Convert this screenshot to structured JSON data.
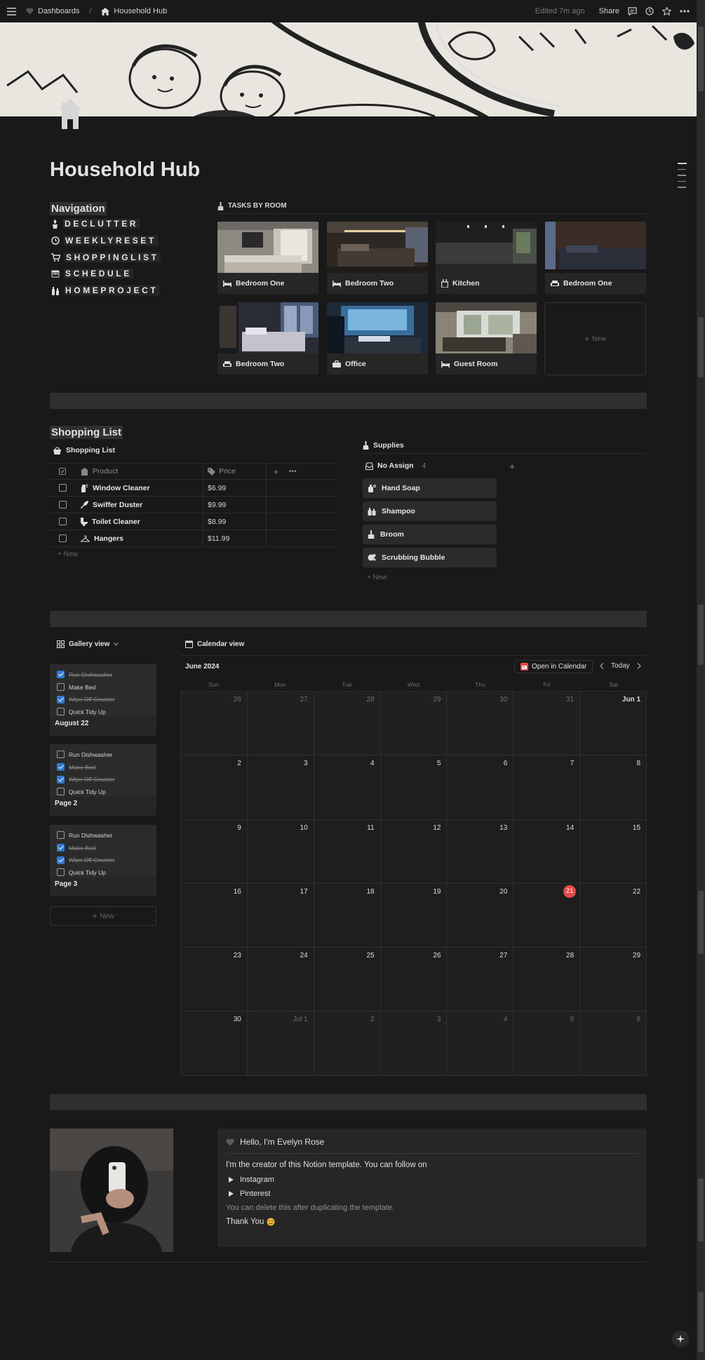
{
  "topbar": {
    "breadcrumb_parent": "Dashboards",
    "breadcrumb_current": "Household Hub",
    "edited": "Edited 7m ago",
    "share": "Share"
  },
  "page": {
    "title": "Household Hub"
  },
  "navigation": {
    "heading": "Navigation",
    "items": [
      {
        "label": "DECLUTTER",
        "icon": "broom-icon"
      },
      {
        "label": "WEEKLYRESET",
        "icon": "clock-icon"
      },
      {
        "label": "SHOPPINGLIST",
        "icon": "cart-icon"
      },
      {
        "label": "SCHEDULE",
        "icon": "calendar-icon"
      },
      {
        "label": "HOMEPROJECT",
        "icon": "bottles-icon"
      }
    ]
  },
  "rooms": {
    "header": "TASKS BY ROOM",
    "cards": [
      {
        "name": "Bedroom One",
        "icon": "bed-icon"
      },
      {
        "name": "Bedroom Two",
        "icon": "bed-icon"
      },
      {
        "name": "Kitchen",
        "icon": "kitchen-icon"
      },
      {
        "name": "Bedroom One",
        "icon": "sofa-icon"
      },
      {
        "name": "Bedroom Two",
        "icon": "sofa-icon"
      },
      {
        "name": "Office",
        "icon": "briefcase-icon"
      },
      {
        "name": "Guest Room",
        "icon": "bed-icon"
      }
    ],
    "new_label": "New"
  },
  "shopping": {
    "heading": "Shopping List",
    "db_title": "Shopping List",
    "columns": {
      "product": "Product",
      "price": "Price"
    },
    "rows": [
      {
        "product": "Window Cleaner",
        "price": "$6.99"
      },
      {
        "product": "Swiffer Duster",
        "price": "$9.99"
      },
      {
        "product": "Toilet Cleaner",
        "price": "$8.99"
      },
      {
        "product": "Hangers",
        "price": "$11.99"
      }
    ],
    "new_label": "New"
  },
  "supplies": {
    "header": "Supplies",
    "group": "No Assign",
    "count": "4",
    "items": [
      "Hand Soap",
      "Shampoo",
      "Broom",
      "Scrubbing Bubble"
    ],
    "new_label": "New"
  },
  "gallery": {
    "tab": "Gallery view",
    "cards": [
      {
        "title": "August 22",
        "tasks": [
          {
            "label": "Run Dishwasher",
            "done": true
          },
          {
            "label": "Make Bed",
            "done": false
          },
          {
            "label": "Wipe Off Counter",
            "done": true
          },
          {
            "label": "Quick Tidy Up",
            "done": false
          }
        ]
      },
      {
        "title": "Page 2",
        "tasks": [
          {
            "label": "Run Dishwasher",
            "done": false
          },
          {
            "label": "Make Bed",
            "done": true
          },
          {
            "label": "Wipe Off Counter",
            "done": true
          },
          {
            "label": "Quick Tidy Up",
            "done": false
          }
        ]
      },
      {
        "title": "Page 3",
        "tasks": [
          {
            "label": "Run Dishwasher",
            "done": false
          },
          {
            "label": "Make Bed",
            "done": true
          },
          {
            "label": "Wipe Off Counter",
            "done": true
          },
          {
            "label": "Quick Tidy Up",
            "done": false
          }
        ]
      }
    ],
    "new_label": "New"
  },
  "calendar": {
    "tab": "Calendar view",
    "month": "June 2024",
    "open_label": "Open in Calendar",
    "today_label": "Today",
    "weekdays": [
      "Sun",
      "Mon",
      "Tue",
      "Wed",
      "Thu",
      "Fri",
      "Sat"
    ],
    "weeks": [
      [
        "26",
        "27",
        "28",
        "29",
        "30",
        "31",
        "Jun 1"
      ],
      [
        "2",
        "3",
        "4",
        "5",
        "6",
        "7",
        "8"
      ],
      [
        "9",
        "10",
        "11",
        "12",
        "13",
        "14",
        "15"
      ],
      [
        "16",
        "17",
        "18",
        "19",
        "20",
        "21",
        "22"
      ],
      [
        "23",
        "24",
        "25",
        "26",
        "27",
        "28",
        "29"
      ],
      [
        "30",
        "Jul 1",
        "2",
        "3",
        "4",
        "5",
        "6"
      ]
    ],
    "today": "21"
  },
  "about": {
    "greeting": "Hello, I'm Evelyn Rose",
    "intro": "I'm the creator of this Notion template. You can follow on",
    "links": [
      "Instagram",
      "Pinterest"
    ],
    "note": "You can delete this after duplicating the template.",
    "thanks": "Thank You"
  },
  "colors": {
    "background": "#191919",
    "accent_blue": "#2e7ad1",
    "today_red": "#e34a4a"
  }
}
